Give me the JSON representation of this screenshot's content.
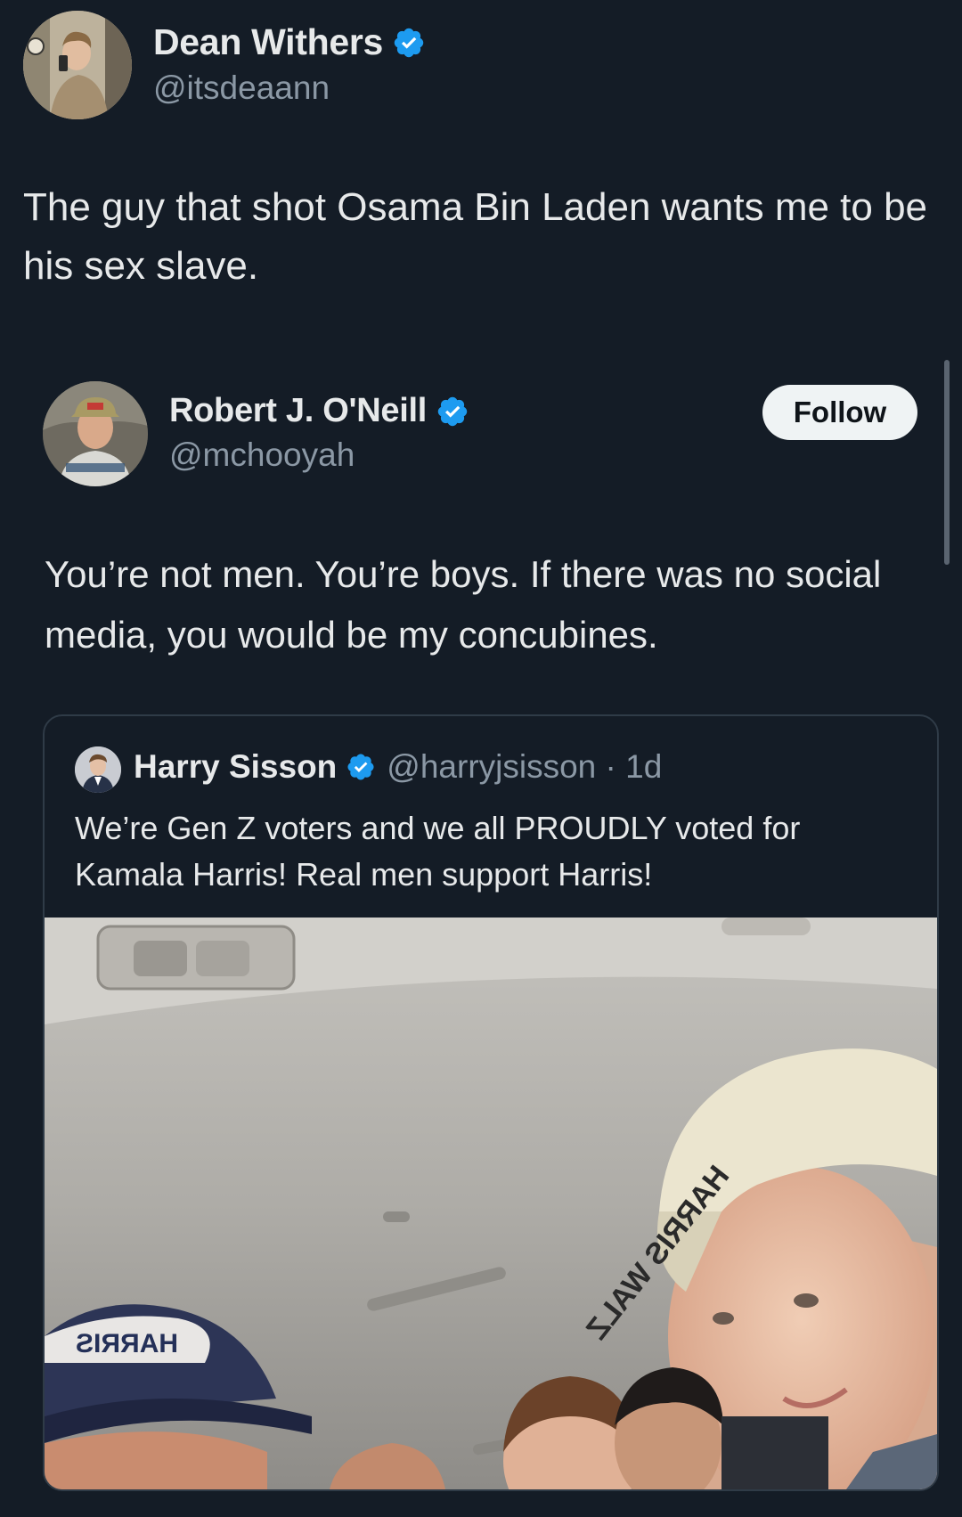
{
  "outer_tweet": {
    "display_name": "Dean Withers",
    "handle": "@itsdeaann",
    "text": "The guy that shot Osama Bin Laden wants me to be his sex slave."
  },
  "quoted_tweet": {
    "display_name": "Robert J. O'Neill",
    "handle": "@mchooyah",
    "follow_label": "Follow",
    "text": "You’re not men. You’re boys. If there was no social media, you would be my concubines."
  },
  "nested_quote": {
    "display_name": "Harry Sisson",
    "handle_time": "@harryjsisson · 1d",
    "text": "We’re Gen Z voters and we all PROUDLY voted for Kamala Harris! Real men support Harris!",
    "photo": {
      "cap_right_text": "HARRIS WALZ",
      "cap_left_text": "HARRIS"
    }
  },
  "colors": {
    "background": "#141c26",
    "verified_blue": "#1d9bf0",
    "secondary_text": "#8b98a5"
  },
  "icons": {
    "verified": "verified-badge-icon"
  }
}
